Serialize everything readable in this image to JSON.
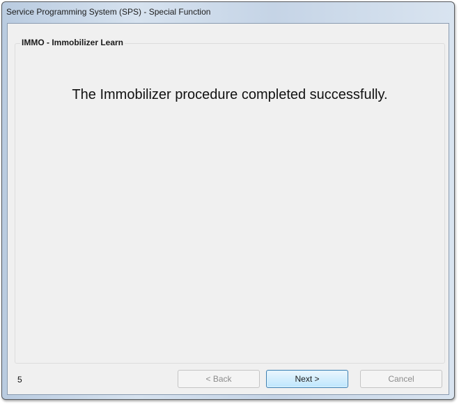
{
  "window": {
    "title": "Service Programming System (SPS) - Special Function"
  },
  "group": {
    "title": "IMMO - Immobilizer Learn"
  },
  "message": "The Immobilizer procedure completed successfully.",
  "footer": {
    "step_number": "5",
    "back_label": "< Back",
    "next_label": "Next >",
    "cancel_label": "Cancel"
  },
  "colors": {
    "titlebar_accent": "#c5d4e6",
    "default_button": "#bee6fd"
  }
}
